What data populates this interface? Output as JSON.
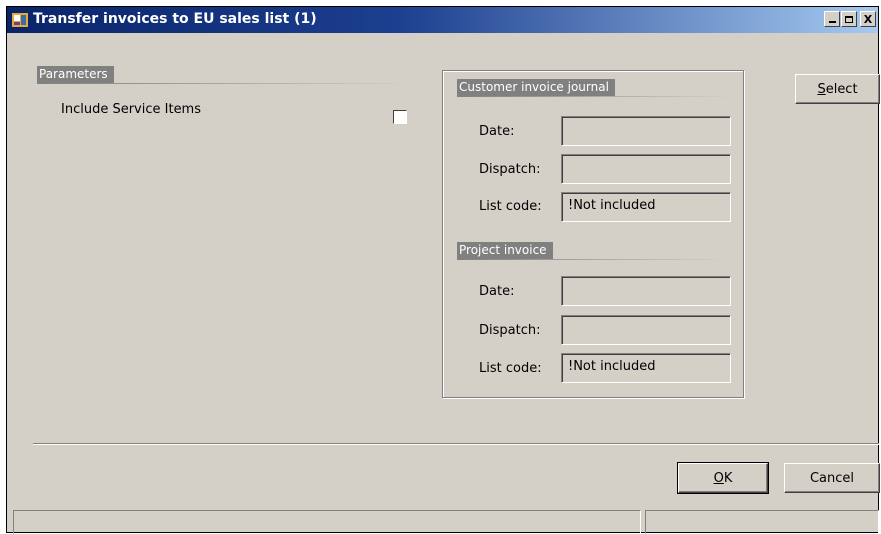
{
  "window": {
    "title": "Transfer invoices to EU sales list (1)",
    "buttons": {
      "minimize": "_",
      "maximize": "□",
      "close": "X"
    }
  },
  "parameters": {
    "header": "Parameters",
    "include_service_items_label": "Include Service Items",
    "include_service_items_checked": false
  },
  "customer_invoice_journal": {
    "header": "Customer invoice journal",
    "date_label": "Date:",
    "date_value": "",
    "dispatch_label": "Dispatch:",
    "dispatch_value": "",
    "list_code_label": "List code:",
    "list_code_value": "!Not included"
  },
  "project_invoice": {
    "header": "Project invoice",
    "date_label": "Date:",
    "date_value": "",
    "dispatch_label": "Dispatch:",
    "dispatch_value": "",
    "list_code_label": "List code:",
    "list_code_value": "!Not included"
  },
  "actions": {
    "select_prefix": "S",
    "select_rest": "elect",
    "ok_prefix": "O",
    "ok_rest": "K",
    "cancel_label": "Cancel"
  },
  "status_bar": {
    "left": "",
    "right": ""
  }
}
